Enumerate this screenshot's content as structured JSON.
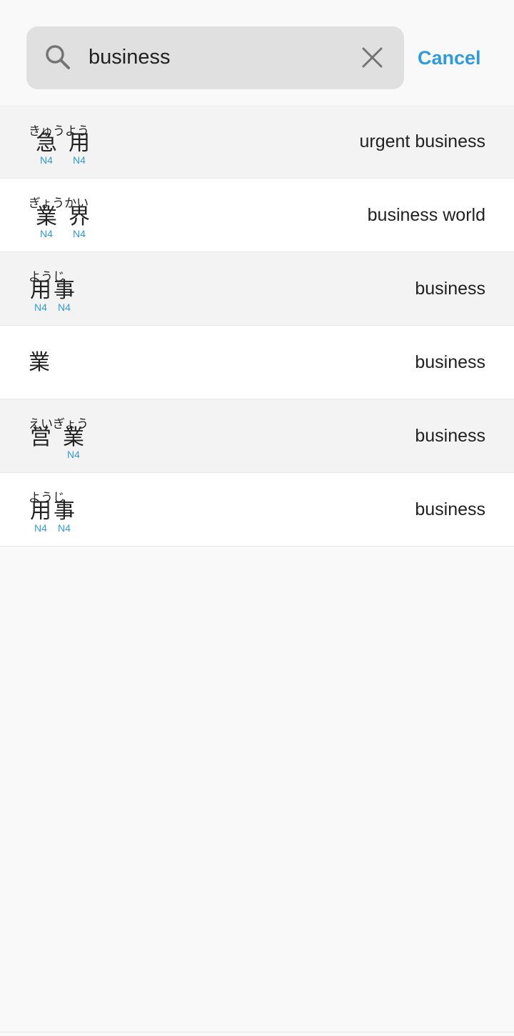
{
  "search": {
    "value": "business",
    "cancel_label": "Cancel"
  },
  "colors": {
    "accent": "#2e9bdf",
    "row_alt": "#f3f3f3",
    "row_plain": "#ffffff",
    "search_bg": "#e0e0e0"
  },
  "icons": {
    "search": "search-icon",
    "clear": "close-icon"
  },
  "results": [
    {
      "reading": "きゅうよう",
      "kanji": [
        {
          "char": "急",
          "level": "N4"
        },
        {
          "char": "用",
          "level": "N4"
        }
      ],
      "meaning": "urgent business"
    },
    {
      "reading": "ぎょうかい",
      "kanji": [
        {
          "char": "業",
          "level": "N4"
        },
        {
          "char": "界",
          "level": "N4"
        }
      ],
      "meaning": "business world"
    },
    {
      "reading": "ようじ",
      "kanji": [
        {
          "char": "用",
          "level": "N4"
        },
        {
          "char": "事",
          "level": "N4"
        }
      ],
      "meaning": "business"
    },
    {
      "reading": "",
      "kanji": [
        {
          "char": "業",
          "level": ""
        }
      ],
      "meaning": "business"
    },
    {
      "reading": "えいぎょう",
      "kanji": [
        {
          "char": "営",
          "level": ""
        },
        {
          "char": "業",
          "level": "N4"
        }
      ],
      "meaning": "business"
    },
    {
      "reading": "ようじ",
      "kanji": [
        {
          "char": "用",
          "level": "N4"
        },
        {
          "char": "事",
          "level": "N4"
        }
      ],
      "meaning": "business"
    }
  ]
}
